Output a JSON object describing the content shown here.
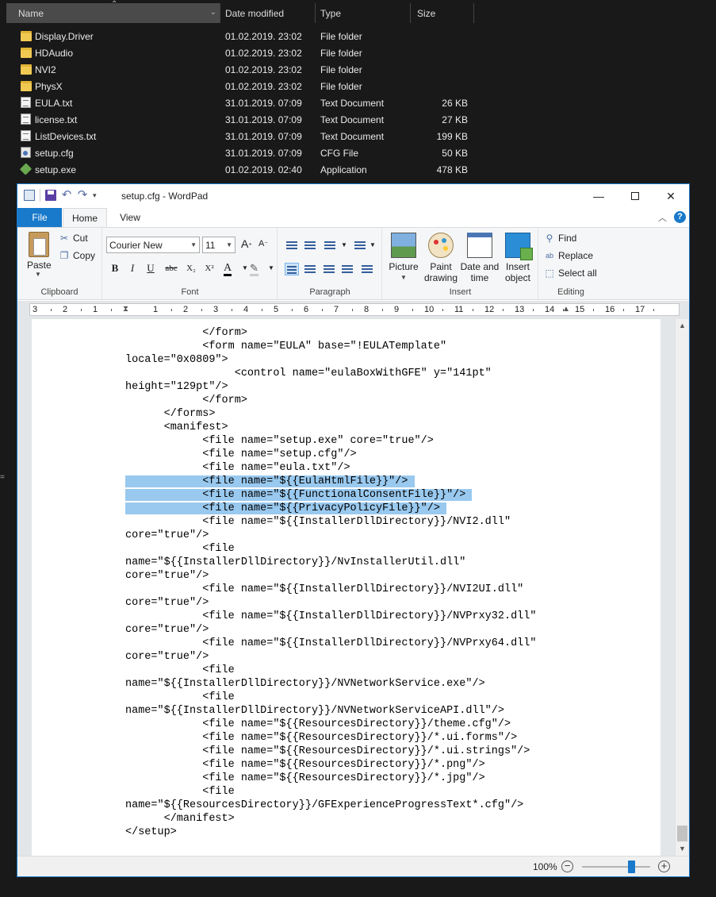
{
  "explorer": {
    "columns": [
      "Name",
      "Date modified",
      "Type",
      "Size"
    ],
    "files": [
      {
        "name": "Display.Driver",
        "date": "01.02.2019. 23:02",
        "type": "File folder",
        "size": "",
        "icon": "folder-icon"
      },
      {
        "name": "HDAudio",
        "date": "01.02.2019. 23:02",
        "type": "File folder",
        "size": "",
        "icon": "folder-icon"
      },
      {
        "name": "NVI2",
        "date": "01.02.2019. 23:02",
        "type": "File folder",
        "size": "",
        "icon": "folder-icon"
      },
      {
        "name": "PhysX",
        "date": "01.02.2019. 23:02",
        "type": "File folder",
        "size": "",
        "icon": "folder-icon"
      },
      {
        "name": "EULA.txt",
        "date": "31.01.2019. 07:09",
        "type": "Text Document",
        "size": "26 KB",
        "icon": "text-file-icon"
      },
      {
        "name": "license.txt",
        "date": "31.01.2019. 07:09",
        "type": "Text Document",
        "size": "27 KB",
        "icon": "text-file-icon"
      },
      {
        "name": "ListDevices.txt",
        "date": "31.01.2019. 07:09",
        "type": "Text Document",
        "size": "199 KB",
        "icon": "text-file-icon"
      },
      {
        "name": "setup.cfg",
        "date": "31.01.2019. 07:09",
        "type": "CFG File",
        "size": "50 KB",
        "icon": "cfg-file-icon"
      },
      {
        "name": "setup.exe",
        "date": "01.02.2019. 02:40",
        "type": "Application",
        "size": "478 KB",
        "icon": "exe-file-icon"
      }
    ]
  },
  "wordpad": {
    "title": "setup.cfg - WordPad",
    "tabs": {
      "file": "File",
      "home": "Home",
      "view": "View"
    },
    "clipboard": {
      "paste": "Paste",
      "cut": "Cut",
      "copy": "Copy",
      "label": "Clipboard"
    },
    "font": {
      "name": "Courier New",
      "size": "11",
      "label": "Font",
      "grow": "A",
      "shrink": "A",
      "bold": "B",
      "italic": "I",
      "underline": "U",
      "strike": "abc",
      "subscript": "X₂",
      "superscript": "X²",
      "color": "A"
    },
    "paragraph": {
      "label": "Paragraph"
    },
    "insert": {
      "picture": "Picture",
      "paint_1": "Paint",
      "paint_2": "drawing",
      "datetime_1": "Date and",
      "datetime_2": "time",
      "object_1": "Insert",
      "object_2": "object",
      "label": "Insert"
    },
    "editing": {
      "find": "Find",
      "replace": "Replace",
      "select_all": "Select all",
      "label": "Editing"
    },
    "ruler_numbers": [
      "3",
      "2",
      "1",
      "1",
      "2",
      "3",
      "4",
      "5",
      "6",
      "7",
      "8",
      "9",
      "10",
      "11",
      "12",
      "13",
      "14",
      "15",
      "16",
      "17"
    ],
    "document_lines": [
      {
        "text": "            </form>",
        "sel": false
      },
      {
        "text": "            <form name=\"EULA\" base=\"!EULATemplate\"",
        "sel": false
      },
      {
        "text": "locale=\"0x0809\">",
        "sel": false
      },
      {
        "text": "                 <control name=\"eulaBoxWithGFE\" y=\"141pt\"",
        "sel": false
      },
      {
        "text": "height=\"129pt\"/>",
        "sel": false
      },
      {
        "text": "            </form>",
        "sel": false
      },
      {
        "text": "      </forms>",
        "sel": false
      },
      {
        "text": "      <manifest>",
        "sel": false
      },
      {
        "text": "            <file name=\"setup.exe\" core=\"true\"/>",
        "sel": false
      },
      {
        "text": "            <file name=\"setup.cfg\"/>",
        "sel": false
      },
      {
        "text": "            <file name=\"eula.txt\"/>",
        "sel": false
      },
      {
        "text": "            <file name=\"${{EulaHtmlFile}}\"/> ",
        "sel": true
      },
      {
        "text": "            <file name=\"${{FunctionalConsentFile}}\"/> ",
        "sel": true
      },
      {
        "text": "            <file name=\"${{PrivacyPolicyFile}}\"/> ",
        "sel": true
      },
      {
        "text": "            <file name=\"${{InstallerDllDirectory}}/NVI2.dll\"",
        "sel": false
      },
      {
        "text": "core=\"true\"/>",
        "sel": false
      },
      {
        "text": "            <file",
        "sel": false
      },
      {
        "text": "name=\"${{InstallerDllDirectory}}/NvInstallerUtil.dll\"",
        "sel": false
      },
      {
        "text": "core=\"true\"/>",
        "sel": false
      },
      {
        "text": "            <file name=\"${{InstallerDllDirectory}}/NVI2UI.dll\"",
        "sel": false
      },
      {
        "text": "core=\"true\"/>",
        "sel": false
      },
      {
        "text": "            <file name=\"${{InstallerDllDirectory}}/NVPrxy32.dll\"",
        "sel": false
      },
      {
        "text": "core=\"true\"/>",
        "sel": false
      },
      {
        "text": "            <file name=\"${{InstallerDllDirectory}}/NVPrxy64.dll\"",
        "sel": false
      },
      {
        "text": "core=\"true\"/>",
        "sel": false
      },
      {
        "text": "            <file",
        "sel": false
      },
      {
        "text": "name=\"${{InstallerDllDirectory}}/NVNetworkService.exe\"/>",
        "sel": false
      },
      {
        "text": "            <file",
        "sel": false
      },
      {
        "text": "name=\"${{InstallerDllDirectory}}/NVNetworkServiceAPI.dll\"/>",
        "sel": false
      },
      {
        "text": "            <file name=\"${{ResourcesDirectory}}/theme.cfg\"/>",
        "sel": false
      },
      {
        "text": "            <file name=\"${{ResourcesDirectory}}/*.ui.forms\"/>",
        "sel": false
      },
      {
        "text": "            <file name=\"${{ResourcesDirectory}}/*.ui.strings\"/>",
        "sel": false
      },
      {
        "text": "            <file name=\"${{ResourcesDirectory}}/*.png\"/>",
        "sel": false
      },
      {
        "text": "            <file name=\"${{ResourcesDirectory}}/*.jpg\"/>",
        "sel": false
      },
      {
        "text": "            <file",
        "sel": false
      },
      {
        "text": "name=\"${{ResourcesDirectory}}/GFExperienceProgressText*.cfg\"/>",
        "sel": false
      },
      {
        "text": "      </manifest>",
        "sel": false
      },
      {
        "text": "</setup>",
        "sel": false
      }
    ],
    "zoom": {
      "level": "100%",
      "minus": "−",
      "plus": "+",
      "fraction": 0.5
    }
  }
}
